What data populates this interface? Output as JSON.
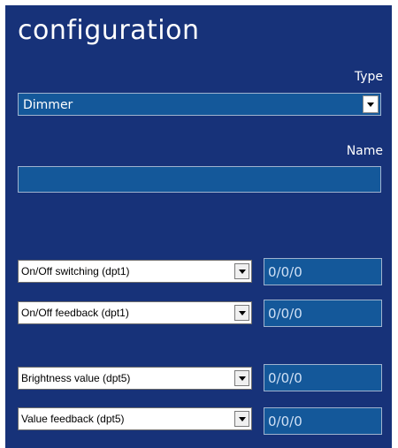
{
  "header": {
    "title": "configuration"
  },
  "type_field": {
    "label": "Type",
    "selected": "Dimmer",
    "dropdown_icon": "chevron-down-icon"
  },
  "name_field": {
    "label": "Name",
    "value": ""
  },
  "rows": [
    {
      "dpt_selected": "On/Off switching (dpt1)",
      "address": "0/0/0"
    },
    {
      "dpt_selected": "On/Off feedback (dpt1)",
      "address": "0/0/0"
    },
    {
      "dpt_selected": "Brightness value (dpt5)",
      "address": "0/0/0"
    },
    {
      "dpt_selected": "Value feedback (dpt5)",
      "address": "0/0/0"
    }
  ],
  "colors": {
    "panel_background": "#173279",
    "field_background": "#14589A",
    "text": "#ffffff"
  }
}
